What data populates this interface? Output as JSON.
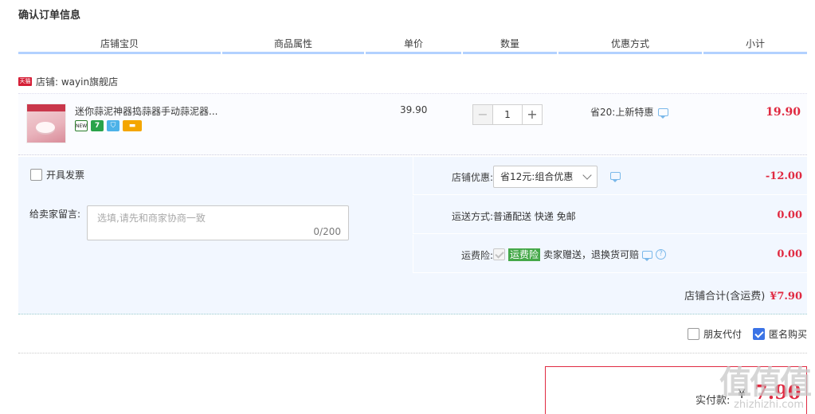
{
  "page": {
    "title": "确认订单信息"
  },
  "table_header": {
    "columns": [
      "店铺宝贝",
      "商品属性",
      "单价",
      "数量",
      "优惠方式",
      "小计"
    ]
  },
  "shop": {
    "badge": "天猫",
    "name": "店铺: wayin旗舰店"
  },
  "item": {
    "name": "迷你蒜泥神器捣蒜器手动蒜泥器...",
    "icons": [
      "new-icon",
      "seven-day-return-icon",
      "guarantee-icon",
      "card-icon"
    ],
    "unit_price": "39.90",
    "quantity": "1",
    "qty_minus": "−",
    "qty_plus": "+",
    "promo": "省20:上新特惠",
    "subtotal": "19.90"
  },
  "invoice": {
    "label": "开具发票",
    "checked": false
  },
  "note": {
    "label": "给卖家留言:",
    "placeholder": "选填,请先和商家协商一致",
    "counter": "0/200"
  },
  "shop_discount": {
    "label": "店铺优惠:",
    "selected": "省12元:组合优惠",
    "amount": "-12.00"
  },
  "shipping": {
    "label": "运送方式:",
    "value": "普通配送 快递 免邮",
    "amount": "0.00"
  },
  "insurance": {
    "label": "运费险:",
    "tag": "运费险",
    "text": "卖家赠送，退换货可赔",
    "amount": "0.00"
  },
  "shop_total": {
    "label": "店铺合计(含运费)",
    "amount": "¥7.90"
  },
  "options": [
    {
      "label": "朋友代付",
      "checked": false
    },
    {
      "label": "匿名购买",
      "checked": true
    }
  ],
  "payment": {
    "label": "实付款:",
    "currency": "¥",
    "amount": "7.90"
  },
  "watermark": {
    "logo": "值值值",
    "url": "zhizhizhi.com"
  },
  "colors": {
    "price_red": "#e02a41",
    "header_rule": "#b2d1ff",
    "panel_bg": "#f2f7ff",
    "tmall_red": "#d51e36",
    "check_blue": "#3b73e6"
  }
}
